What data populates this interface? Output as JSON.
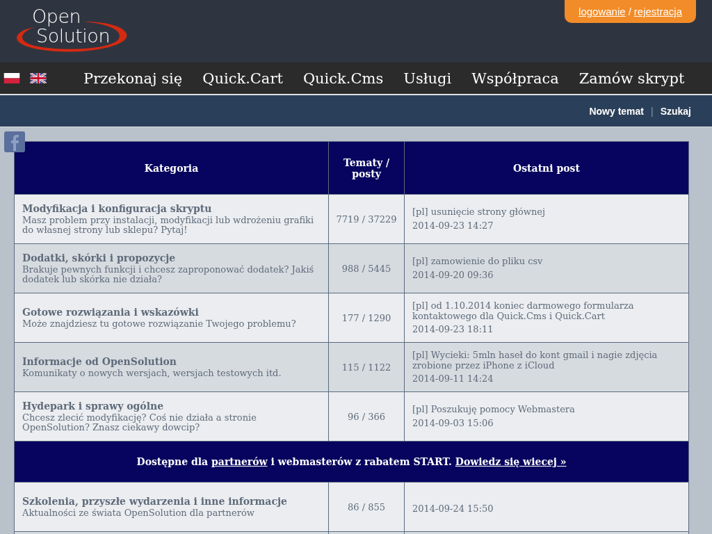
{
  "logo": {
    "line_1": "Open",
    "line_2": "Solution"
  },
  "account": {
    "login": "logowanie",
    "separator": "/",
    "register": "rejestracja"
  },
  "languages": [
    {
      "kind": "pl"
    },
    {
      "kind": "en"
    }
  ],
  "nav": [
    "Przekonaj się",
    "Quick.Cart",
    "Quick.Cms",
    "Usługi",
    "Współpraca",
    "Zamów skrypt"
  ],
  "forum_bar": {
    "new_topic": "Nowy temat",
    "separator": "|",
    "search": "Szukaj"
  },
  "table": {
    "columns": [
      "Kategoria",
      "Tematy / posty",
      "Ostatni post"
    ],
    "rows": [
      {
        "kind": "category",
        "title": "Modyfikacja i konfiguracja skryptu",
        "description": "Masz problem przy instalacji, modyfikacji lub wdrożeniu grafiki do własnej strony lub sklepu? Pytaj!",
        "counts": "7719 / 37229",
        "last_post": "[pl] usunięcie strony głównej",
        "date": "2014-09-23 14:27"
      },
      {
        "kind": "category",
        "title": "Dodatki, skórki i propozycje",
        "description": "Brakuje pewnych funkcji i chcesz zaproponować dodatek? Jakiś dodatek lub skórka nie działa?",
        "counts": "988 / 5445",
        "last_post": "[pl] zamowienie do pliku csv",
        "date": "2014-09-20 09:36"
      },
      {
        "kind": "category",
        "title": "Gotowe rozwiązania i wskazówki",
        "description": "Może znajdziesz tu gotowe rozwiązanie Twojego problemu?",
        "counts": "177 / 1290",
        "last_post": "[pl] od 1.10.2014 koniec darmowego formularza kontaktowego dla Quick.Cms i Quick.Cart",
        "date": "2014-09-23 18:11"
      },
      {
        "kind": "category",
        "title": "Informacje od OpenSolution",
        "description": "Komunikaty o nowych wersjach, wersjach testowych itd.",
        "counts": "115 / 1122",
        "last_post": "[pl] Wycieki: 5mln haseł do kont gmail i nagie zdjęcia zrobione przez iPhone z iCloud",
        "date": "2014-09-11 14:24"
      },
      {
        "kind": "category",
        "title": "Hydepark i sprawy ogólne",
        "description": "Chcesz zlecić modyfikację? Coś nie działa a stronie OpenSolution? Znasz ciekawy dowcip?",
        "counts": "96 / 366",
        "last_post": "[pl] Poszukuję pomocy Webmastera",
        "date": "2014-09-03 15:06"
      },
      {
        "kind": "banner",
        "parts": [
          {
            "kind": "text",
            "text": "Dostępne dla "
          },
          {
            "kind": "link",
            "text": "partnerów"
          },
          {
            "kind": "text",
            "text": " i webmasterów z rabatem START. "
          },
          {
            "kind": "link",
            "text": "Dowiedz się wiecej »"
          }
        ]
      },
      {
        "kind": "category",
        "title": "Szkolenia, przyszłe wydarzenia i inne informacje",
        "description": "Aktualności ze świata OpenSolution dla partnerów",
        "counts": "86 / 855",
        "date": "2014-09-24 15:50"
      },
      {
        "kind": "empty"
      }
    ]
  }
}
